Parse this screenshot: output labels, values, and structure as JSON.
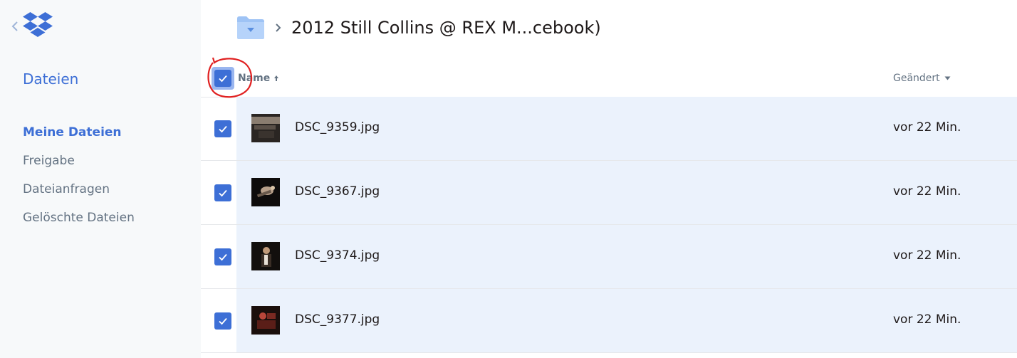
{
  "sidebar": {
    "heading": "Dateien",
    "items": [
      {
        "label": "Meine Dateien",
        "active": true
      },
      {
        "label": "Freigabe",
        "active": false
      },
      {
        "label": "Dateianfragen",
        "active": false
      },
      {
        "label": "Gelöschte Dateien",
        "active": false
      }
    ]
  },
  "breadcrumb": {
    "folder_icon": "folder-icon",
    "title": "2012 Still Collins @ REX M...cebook)"
  },
  "table": {
    "columns": {
      "name": "Name",
      "modified": "Geändert"
    },
    "rows": [
      {
        "name": "DSC_9359.jpg",
        "modified": "vor 22 Min.",
        "selected": true
      },
      {
        "name": "DSC_9367.jpg",
        "modified": "vor 22 Min.",
        "selected": true
      },
      {
        "name": "DSC_9374.jpg",
        "modified": "vor 22 Min.",
        "selected": true
      },
      {
        "name": "DSC_9377.jpg",
        "modified": "vor 22 Min.",
        "selected": true
      }
    ]
  },
  "colors": {
    "accent": "#3d6fd6",
    "selected_row": "#ebf2fc",
    "annotation": "#e02020"
  }
}
